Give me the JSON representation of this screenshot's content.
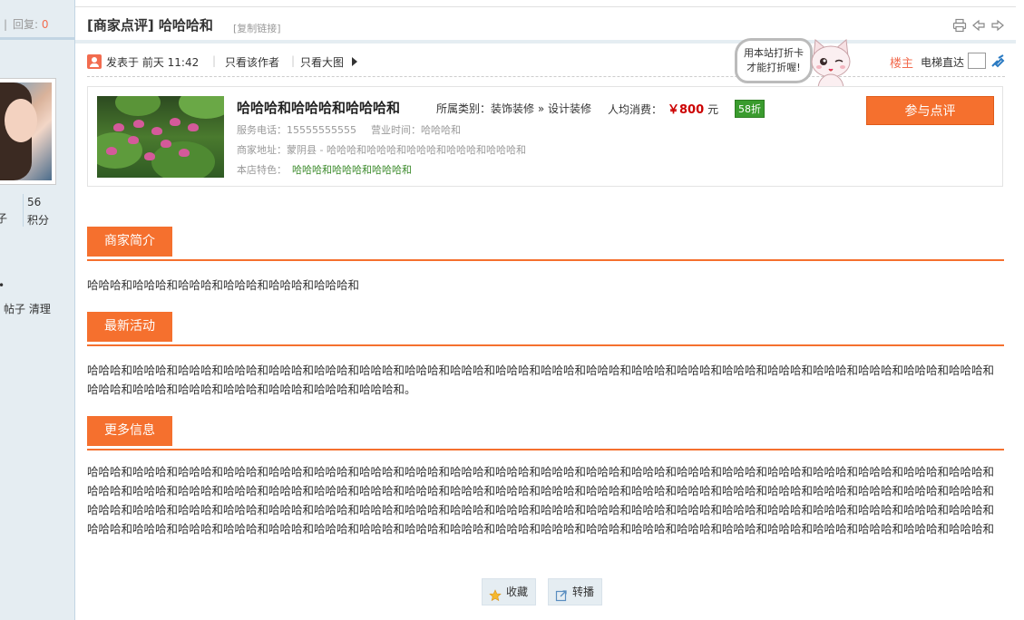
{
  "sidebar": {
    "reply_sep": "|",
    "reply_label": "回复:",
    "reply_count": "0",
    "left_stat_text": "子",
    "points_value": "56",
    "points_label": "积分",
    "dot": "•",
    "ops": "帖子 清理"
  },
  "header": {
    "title": "[商家点评] 哈哈哈和",
    "copy_link": "[复制链接]",
    "icons": [
      "print-icon",
      "prev-thread-icon",
      "next-thread-icon"
    ]
  },
  "meta": {
    "posted": "发表于  前天 11:42",
    "sep": "|",
    "only_author": "只看该作者",
    "only_big_image": "只看大图",
    "floor_label": "楼主",
    "elevator_label": "电梯直达"
  },
  "mascot": {
    "line1": "用本站打折卡",
    "line2": "才能打折喔!"
  },
  "shop": {
    "name": "哈哈哈和哈哈哈和哈哈哈和",
    "category_label": "所属类别：装饰装修 » 设计装修",
    "avg_label": "人均消费：",
    "price": "￥800",
    "price_unit": "元",
    "discount": "58折",
    "review_button": "参与点评",
    "phone": "服务电话：15555555555",
    "hours": "营业时间：哈哈哈和",
    "address": "商家地址：蒙阴县 - 哈哈哈和哈哈哈和哈哈哈和哈哈哈和哈哈哈和",
    "features_label": "本店特色：",
    "features": "哈哈哈和哈哈哈和哈哈哈和"
  },
  "sections": [
    {
      "title": "商家简介",
      "body": "哈哈哈和哈哈哈和哈哈哈和哈哈哈和哈哈哈和哈哈哈和"
    },
    {
      "title": "最新活动",
      "body": "哈哈哈和哈哈哈和哈哈哈和哈哈哈和哈哈哈和哈哈哈和哈哈哈和哈哈哈和哈哈哈和哈哈哈和哈哈哈和哈哈哈和哈哈哈和哈哈哈和哈哈哈和哈哈哈和哈哈哈和哈哈哈和哈哈哈和哈哈哈和哈哈哈和哈哈哈和哈哈哈和哈哈哈和哈哈哈和哈哈哈和哈哈哈和。"
    },
    {
      "title": "更多信息",
      "body": "哈哈哈和哈哈哈和哈哈哈和哈哈哈和哈哈哈和哈哈哈和哈哈哈和哈哈哈和哈哈哈和哈哈哈和哈哈哈和哈哈哈和哈哈哈和哈哈哈和哈哈哈和哈哈哈和哈哈哈和哈哈哈和哈哈哈和哈哈哈和哈哈哈和哈哈哈和哈哈哈和哈哈哈和哈哈哈和哈哈哈和哈哈哈和哈哈哈和哈哈哈和哈哈哈和哈哈哈和哈哈哈和哈哈哈和哈哈哈和哈哈哈和哈哈哈和哈哈哈和哈哈哈和哈哈哈和哈哈哈和哈哈哈和哈哈哈和哈哈哈和哈哈哈和哈哈哈和哈哈哈和哈哈哈和哈哈哈和哈哈哈和哈哈哈和哈哈哈和哈哈哈和哈哈哈和哈哈哈和哈哈哈和哈哈哈和哈哈哈和哈哈哈和哈哈哈和哈哈哈和哈哈哈和哈哈哈和哈哈哈和哈哈哈和哈哈哈和哈哈哈和哈哈哈和哈哈哈和哈哈哈和哈哈哈和哈哈哈和哈哈哈和哈哈哈和哈哈哈和哈哈哈和哈哈哈和哈哈哈和哈哈哈和哈哈哈和哈哈哈和"
    }
  ],
  "actions": {
    "favorite": "收藏",
    "share": "转播"
  },
  "colors": {
    "accent": "#f5702e",
    "price": "#cc0000",
    "discount_bg": "#3a9b2e",
    "sidebar_bg": "#e5edf2"
  }
}
